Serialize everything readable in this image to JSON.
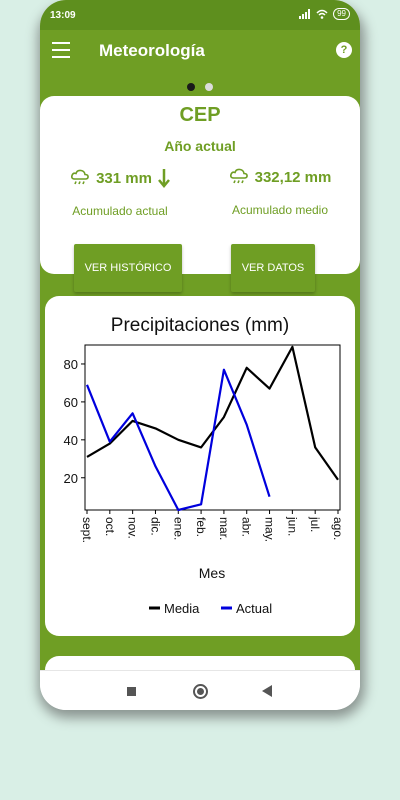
{
  "status_bar": {
    "time": "13:09",
    "battery": "99"
  },
  "app_bar": {
    "title": "Meteorología",
    "help_icon": "?"
  },
  "pager": {
    "pages": 2,
    "active": 0
  },
  "summary_card": {
    "title": "CEP",
    "subtitle": "Año actual",
    "current": {
      "value": "331 mm",
      "label": "Acumulado actual",
      "trend_icon": "arrow-down-icon"
    },
    "average": {
      "value": "332,12 mm",
      "label": "Acumulado medio"
    },
    "btn_history": "VER HISTÓRICO",
    "btn_data": "VER DATOS"
  },
  "colors": {
    "primary": "#6f9e24",
    "primary_dark": "#5e8f1e",
    "media": "#000000",
    "actual": "#0000dd"
  },
  "chart_data": {
    "type": "line",
    "title": "Precipitaciones (mm)",
    "xlabel": "Mes",
    "ylabel": "",
    "categories": [
      "sept.",
      "oct.",
      "nov.",
      "dic.",
      "ene.",
      "feb.",
      "mar.",
      "abr.",
      "may.",
      "jun.",
      "jul.",
      "ago."
    ],
    "yticks": [
      20,
      40,
      60,
      80
    ],
    "ylim": [
      3,
      90
    ],
    "grid": false,
    "legend_position": "bottom",
    "series": [
      {
        "name": "Media",
        "color": "#000000",
        "values": [
          31,
          38,
          50,
          46,
          40,
          36,
          52,
          78,
          67,
          89,
          36,
          19
        ]
      },
      {
        "name": "Actual",
        "color": "#0000dd",
        "values": [
          69,
          39,
          54,
          26,
          3,
          6,
          77,
          48,
          10
        ]
      }
    ]
  }
}
